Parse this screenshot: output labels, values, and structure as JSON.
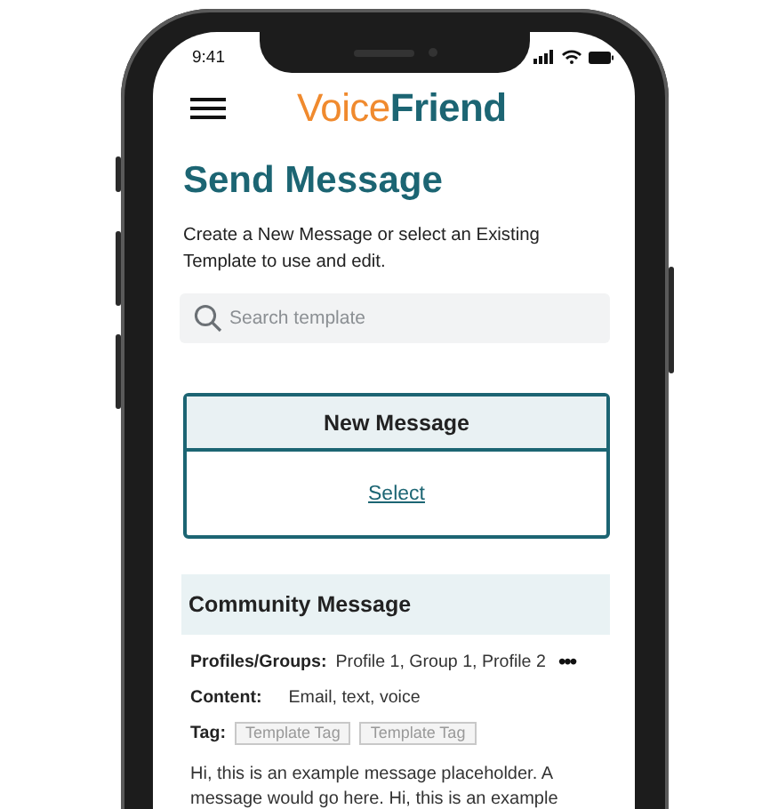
{
  "status_bar": {
    "time": "9:41"
  },
  "header": {
    "logo_first": "Voice",
    "logo_second": "Friend"
  },
  "title": "Send Message",
  "description": "Create a New Message or select an Existing Template to use and edit.",
  "search": {
    "placeholder": "Search template"
  },
  "new_message": {
    "title": "New Message",
    "link": "Select"
  },
  "template": {
    "title": "Community Message",
    "profiles": {
      "label": "Profiles/Groups:",
      "value": "Profile 1, Group 1, Profile 2",
      "more": "•••"
    },
    "content": {
      "label": "Content:",
      "value": "Email, text, voice"
    },
    "tags": {
      "label": "Tag:",
      "items": [
        "Template Tag",
        "Template Tag"
      ]
    },
    "body": "Hi, this is an example message placeholder. A message would go here. Hi, this is an example"
  }
}
